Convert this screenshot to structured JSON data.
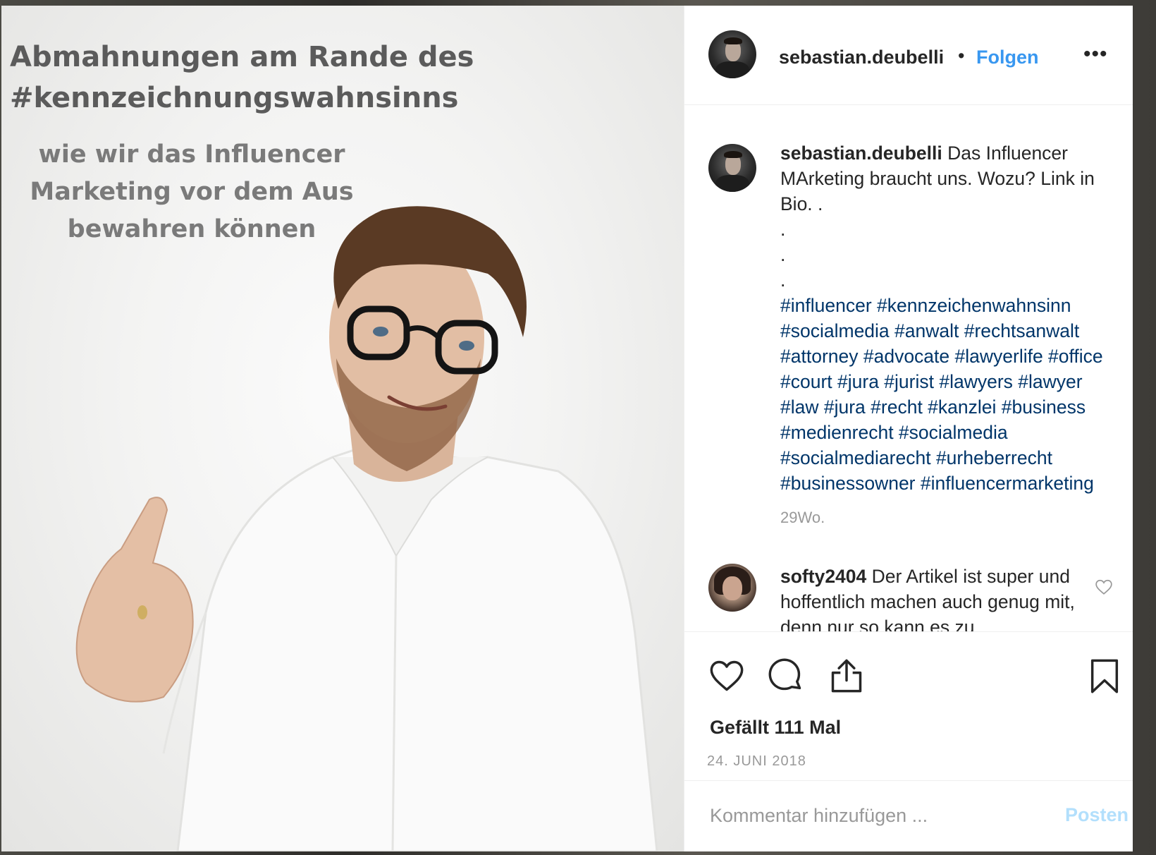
{
  "post": {
    "image_title": "Abmahnungen am Rande des #kennzeichnungswahnsinns",
    "image_subtitle": "wie wir das Influencer Marketing vor dem Aus bewahren können"
  },
  "header": {
    "username": "sebastian.deubelli",
    "separator": "•",
    "follow_label": "Folgen",
    "more_label": "•••"
  },
  "caption": {
    "username": "sebastian.deubelli",
    "text": "Das Influencer MArketing braucht uns. Wozu? Link in Bio. .",
    "dots": [
      ".",
      ".",
      "."
    ],
    "hashtags": "#influencer #kennzeichenwahnsinn #socialmedia #anwalt #rechtsanwalt #attorney #advocate #lawyerlife #office #court #jura #jurist #lawyers #lawyer #law #jura #recht #kanzlei #business #medienrecht #socialmedia #socialmediarecht #urheberrecht #businessowner #influencermarketing",
    "age": "29Wo."
  },
  "comments": [
    {
      "username": "softy2404",
      "text": "Der Artikel ist super und hoffentlich machen auch genug mit, denn nur so kann es zu"
    }
  ],
  "actions": {
    "like_icon": "heart-icon",
    "comment_icon": "speech-bubble-icon",
    "share_icon": "share-icon",
    "save_icon": "bookmark-icon"
  },
  "likes_text": "Gefällt 111 Mal",
  "date_text": "24. JUNI 2018",
  "comment_box": {
    "placeholder": "Kommentar hinzufügen ...",
    "post_label": "Posten"
  },
  "colors": {
    "link_blue": "#3897f0",
    "hashtag_blue": "#003569",
    "muted_gray": "#999999",
    "post_disabled": "#b2dffc"
  }
}
